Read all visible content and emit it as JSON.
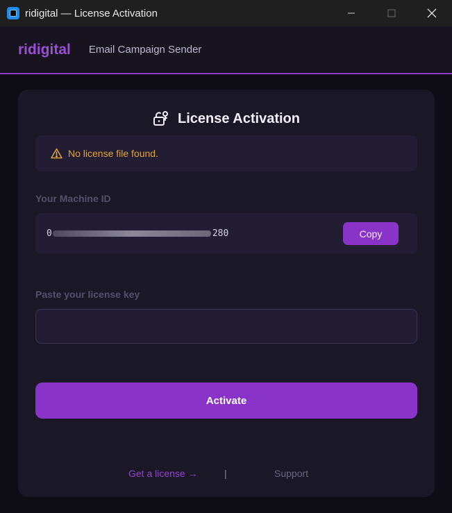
{
  "window": {
    "title": "ridigital — License Activation",
    "minimize_icon": "minimize-icon",
    "maximize_icon": "maximize-icon",
    "close_icon": "close-icon"
  },
  "header": {
    "brand": "ridigital",
    "subtitle": "Email Campaign Sender"
  },
  "card": {
    "title": "License Activation",
    "title_icon": "lock-key-icon",
    "alert": {
      "icon": "warning-icon",
      "text": "No license file found."
    },
    "machine_id": {
      "label": "Your Machine ID",
      "value_prefix": "0",
      "value_suffix": "280",
      "copy_label": "Copy"
    },
    "license_key": {
      "label": "Paste your license key",
      "value": "",
      "placeholder": ""
    },
    "activate_label": "Activate",
    "footer": {
      "get_license": "Get a license →",
      "separator": "|",
      "support": "Support"
    }
  },
  "colors": {
    "accent": "#8a33c8",
    "warning": "#e0a53a",
    "background": "#0e0c15",
    "card": "#1a1726"
  }
}
